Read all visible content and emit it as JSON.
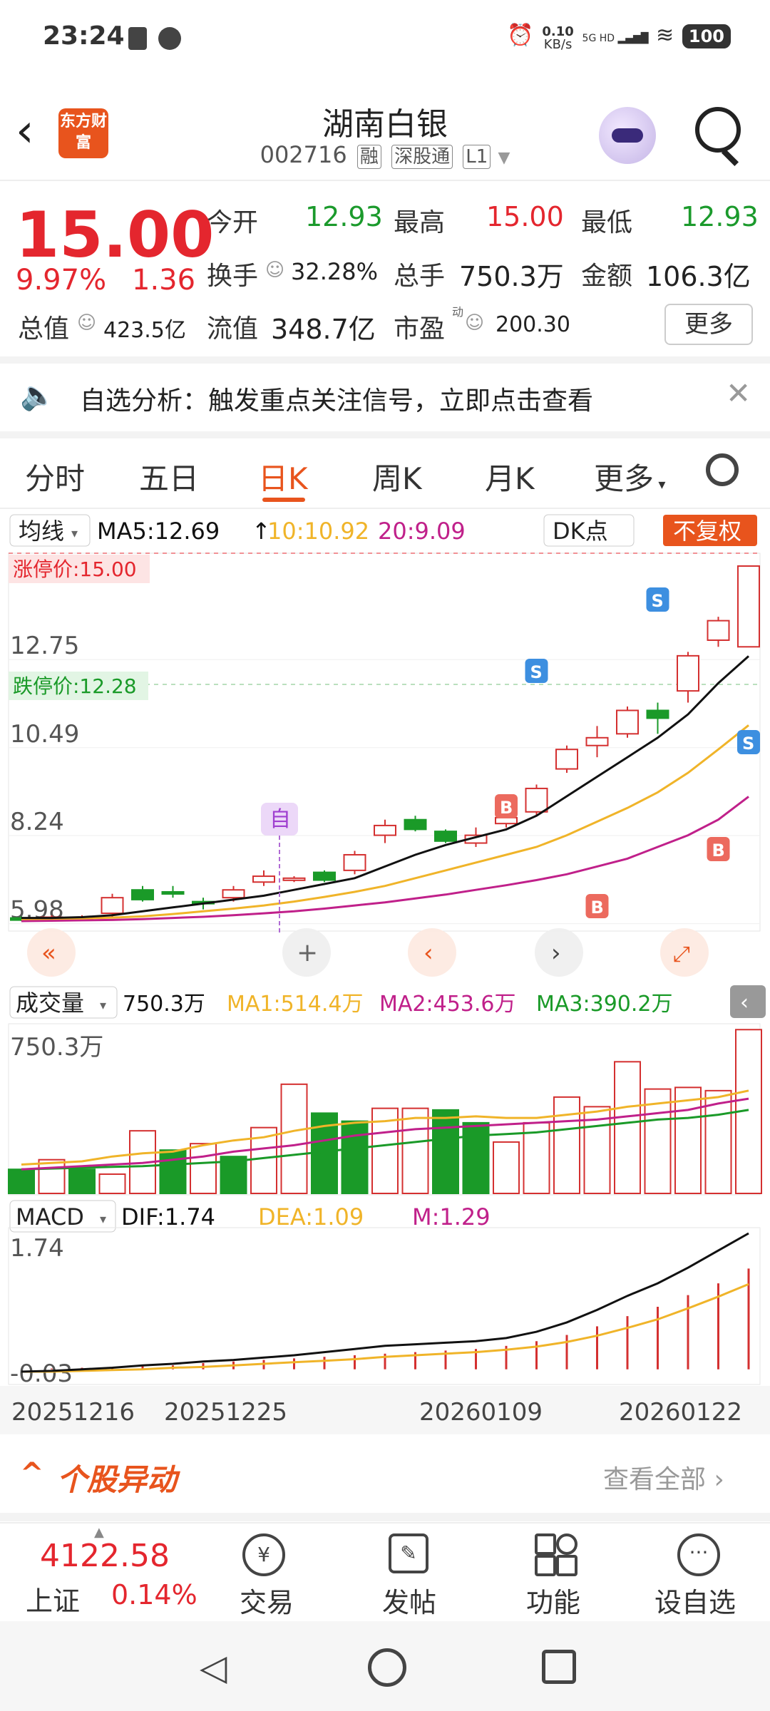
{
  "status_bar": {
    "time": "23:24",
    "net_speed": "0.10",
    "net_unit": "KB/s",
    "network": "5G HD",
    "battery": "100"
  },
  "header": {
    "app_logo_text": "东方财富",
    "title": "湖南白银",
    "code": "002716",
    "tags": [
      "融",
      "深股通",
      "L1"
    ]
  },
  "quote": {
    "price": "15.00",
    "change_pct": "9.97%",
    "change": "1.36",
    "open_label": "今开",
    "open": "12.93",
    "high_label": "最高",
    "high": "15.00",
    "low_label": "最低",
    "low": "12.93",
    "turnover_label": "换手",
    "turnover": "32.28%",
    "volume_label": "总手",
    "volume": "750.3万",
    "amount_label": "金额",
    "amount": "106.3亿",
    "mktcap_label": "总值",
    "mktcap": "423.5亿",
    "float_label": "流值",
    "float": "348.7亿",
    "pe_label": "市盈",
    "pe_sup": "动",
    "pe": "200.30",
    "more_label": "更多"
  },
  "alert": {
    "text": "自选分析：触发重点关注信号，立即点击查看"
  },
  "tabs": [
    "分时",
    "五日",
    "日K",
    "周K",
    "月K",
    "更多"
  ],
  "active_tab": "日K",
  "kline": {
    "indicator_label": "均线",
    "ma5": "MA5:12.69",
    "ma10": "10:10.92",
    "ma20": "20:9.09",
    "dk_label": "DK点",
    "adjust_label": "不复权",
    "limit_up": "涨停价:15.00",
    "limit_down": "跌停价:12.28",
    "y_ticks": [
      "12.75",
      "10.49",
      "8.24",
      "5.98"
    ],
    "marker_self": "自",
    "colors": {
      "up": "#d43030",
      "down": "#1a9a28",
      "ma5": "#111111",
      "ma10": "#f0b429",
      "ma20": "#c0208a"
    }
  },
  "volume": {
    "label": "成交量",
    "value": "750.3万",
    "ma1": "MA1:514.4万",
    "ma2": "MA2:453.6万",
    "ma3": "MA3:390.2万",
    "y_top": "750.3万"
  },
  "macd": {
    "label": "MACD",
    "dif": "DIF:1.74",
    "dea": "DEA:1.09",
    "m": "M:1.29",
    "y_top": "1.74",
    "y_bottom": "-0.03"
  },
  "dates": [
    "20251216",
    "20251225",
    "20260109",
    "20260122"
  ],
  "section": {
    "title": "个股异动",
    "view_all": "查看全部"
  },
  "bottom_nav": {
    "index_value": "4122.58",
    "index_name": "上证",
    "index_change": "0.14%",
    "items": [
      "交易",
      "发帖",
      "功能",
      "设自选"
    ]
  },
  "chart_data": {
    "type": "candlestick",
    "candles": [
      {
        "o": 5.98,
        "c": 5.95,
        "h": 6.02,
        "l": 5.9,
        "up": false
      },
      {
        "o": 5.98,
        "c": 6.0,
        "h": 6.05,
        "l": 5.92,
        "up": true
      },
      {
        "o": 6.0,
        "c": 5.98,
        "h": 6.05,
        "l": 5.9,
        "up": true
      },
      {
        "o": 6.1,
        "c": 6.5,
        "h": 6.6,
        "l": 6.0,
        "up": true
      },
      {
        "o": 6.7,
        "c": 6.45,
        "h": 6.8,
        "l": 6.4,
        "up": false
      },
      {
        "o": 6.6,
        "c": 6.65,
        "h": 6.8,
        "l": 6.5,
        "up": false
      },
      {
        "o": 6.4,
        "c": 6.35,
        "h": 6.5,
        "l": 6.2,
        "up": false
      },
      {
        "o": 6.5,
        "c": 6.7,
        "h": 6.8,
        "l": 6.4,
        "up": true
      },
      {
        "o": 6.9,
        "c": 7.05,
        "h": 7.2,
        "l": 6.8,
        "up": true
      },
      {
        "o": 7.0,
        "c": 6.95,
        "h": 7.05,
        "l": 6.9,
        "up": true
      },
      {
        "o": 7.15,
        "c": 6.95,
        "h": 7.2,
        "l": 6.9,
        "up": false
      },
      {
        "o": 7.2,
        "c": 7.6,
        "h": 7.7,
        "l": 7.1,
        "up": true
      },
      {
        "o": 8.1,
        "c": 8.35,
        "h": 8.5,
        "l": 7.9,
        "up": true
      },
      {
        "o": 8.5,
        "c": 8.25,
        "h": 8.6,
        "l": 8.2,
        "up": false
      },
      {
        "o": 8.2,
        "c": 7.95,
        "h": 8.25,
        "l": 7.9,
        "up": false
      },
      {
        "o": 7.9,
        "c": 8.1,
        "h": 8.3,
        "l": 7.8,
        "up": true
      },
      {
        "o": 8.4,
        "c": 8.55,
        "h": 8.6,
        "l": 8.3,
        "up": true
      },
      {
        "o": 8.7,
        "c": 9.3,
        "h": 9.4,
        "l": 8.6,
        "up": true
      },
      {
        "o": 9.8,
        "c": 10.3,
        "h": 10.4,
        "l": 9.7,
        "up": true
      },
      {
        "o": 10.4,
        "c": 10.6,
        "h": 10.9,
        "l": 10.1,
        "up": true
      },
      {
        "o": 10.7,
        "c": 11.3,
        "h": 11.4,
        "l": 10.6,
        "up": true
      },
      {
        "o": 11.3,
        "c": 11.1,
        "h": 11.5,
        "l": 10.7,
        "up": false
      },
      {
        "o": 11.8,
        "c": 12.7,
        "h": 12.8,
        "l": 11.5,
        "up": true
      },
      {
        "o": 13.1,
        "c": 13.6,
        "h": 13.7,
        "l": 12.93,
        "up": true
      },
      {
        "o": 12.93,
        "c": 15.0,
        "h": 15.0,
        "l": 12.93,
        "up": true
      }
    ],
    "ma5": [
      5.98,
      5.98,
      6.0,
      6.05,
      6.15,
      6.25,
      6.35,
      6.45,
      6.55,
      6.7,
      6.85,
      7.0,
      7.3,
      7.6,
      7.85,
      8.05,
      8.25,
      8.6,
      9.1,
      9.6,
      10.1,
      10.6,
      11.2,
      12.0,
      12.69
    ],
    "ma10": [
      5.95,
      5.96,
      5.97,
      5.99,
      6.02,
      6.08,
      6.15,
      6.22,
      6.3,
      6.4,
      6.52,
      6.65,
      6.8,
      7.0,
      7.2,
      7.4,
      7.6,
      7.8,
      8.1,
      8.45,
      8.8,
      9.2,
      9.7,
      10.3,
      10.92
    ],
    "ma20": [
      5.9,
      5.91,
      5.92,
      5.93,
      5.95,
      5.98,
      6.01,
      6.05,
      6.1,
      6.15,
      6.22,
      6.3,
      6.38,
      6.48,
      6.58,
      6.7,
      6.82,
      6.95,
      7.1,
      7.3,
      7.5,
      7.8,
      8.1,
      8.5,
      9.09
    ],
    "volume": [
      {
        "v": 150,
        "up": false
      },
      {
        "v": 210,
        "up": true
      },
      {
        "v": 150,
        "up": false
      },
      {
        "v": 120,
        "up": true
      },
      {
        "v": 390,
        "up": true
      },
      {
        "v": 270,
        "up": false
      },
      {
        "v": 310,
        "up": true
      },
      {
        "v": 230,
        "up": false
      },
      {
        "v": 410,
        "up": true
      },
      {
        "v": 680,
        "up": true
      },
      {
        "v": 500,
        "up": false
      },
      {
        "v": 450,
        "up": false
      },
      {
        "v": 530,
        "up": true
      },
      {
        "v": 530,
        "up": true
      },
      {
        "v": 520,
        "up": false
      },
      {
        "v": 440,
        "up": false
      },
      {
        "v": 320,
        "up": true
      },
      {
        "v": 440,
        "up": true
      },
      {
        "v": 600,
        "up": true
      },
      {
        "v": 540,
        "up": true
      },
      {
        "v": 820,
        "up": true
      },
      {
        "v": 650,
        "up": true
      },
      {
        "v": 660,
        "up": true
      },
      {
        "v": 640,
        "up": true
      },
      {
        "v": 1020,
        "up": true
      }
    ],
    "vol_ma1": [
      180,
      190,
      200,
      230,
      250,
      260,
      300,
      330,
      350,
      390,
      420,
      440,
      450,
      470,
      470,
      480,
      470,
      470,
      490,
      510,
      540,
      560,
      580,
      600,
      640
    ],
    "vol_ma2": [
      150,
      160,
      170,
      180,
      190,
      210,
      230,
      260,
      280,
      300,
      330,
      360,
      380,
      400,
      410,
      420,
      430,
      440,
      450,
      460,
      480,
      500,
      520,
      560,
      590
    ],
    "vol_ma3": [
      150,
      155,
      160,
      165,
      170,
      180,
      190,
      200,
      220,
      240,
      260,
      280,
      300,
      320,
      340,
      360,
      370,
      380,
      400,
      420,
      440,
      460,
      470,
      490,
      520
    ],
    "macd_m": [
      0,
      0.01,
      0.02,
      0.03,
      0.04,
      0.05,
      0.08,
      0.1,
      0.12,
      0.14,
      0.16,
      0.18,
      0.2,
      0.22,
      0.24,
      0.26,
      0.3,
      0.36,
      0.44,
      0.55,
      0.68,
      0.8,
      0.95,
      1.1,
      1.29
    ],
    "macd_dif": [
      -0.03,
      -0.02,
      0.0,
      0.02,
      0.05,
      0.07,
      0.1,
      0.12,
      0.15,
      0.18,
      0.22,
      0.26,
      0.3,
      0.32,
      0.34,
      0.36,
      0.4,
      0.48,
      0.6,
      0.76,
      0.94,
      1.1,
      1.3,
      1.52,
      1.74
    ],
    "macd_dea": [
      -0.03,
      -0.03,
      -0.02,
      -0.01,
      0.0,
      0.02,
      0.03,
      0.05,
      0.07,
      0.09,
      0.11,
      0.13,
      0.16,
      0.18,
      0.2,
      0.22,
      0.25,
      0.29,
      0.35,
      0.43,
      0.53,
      0.64,
      0.78,
      0.93,
      1.09
    ]
  }
}
